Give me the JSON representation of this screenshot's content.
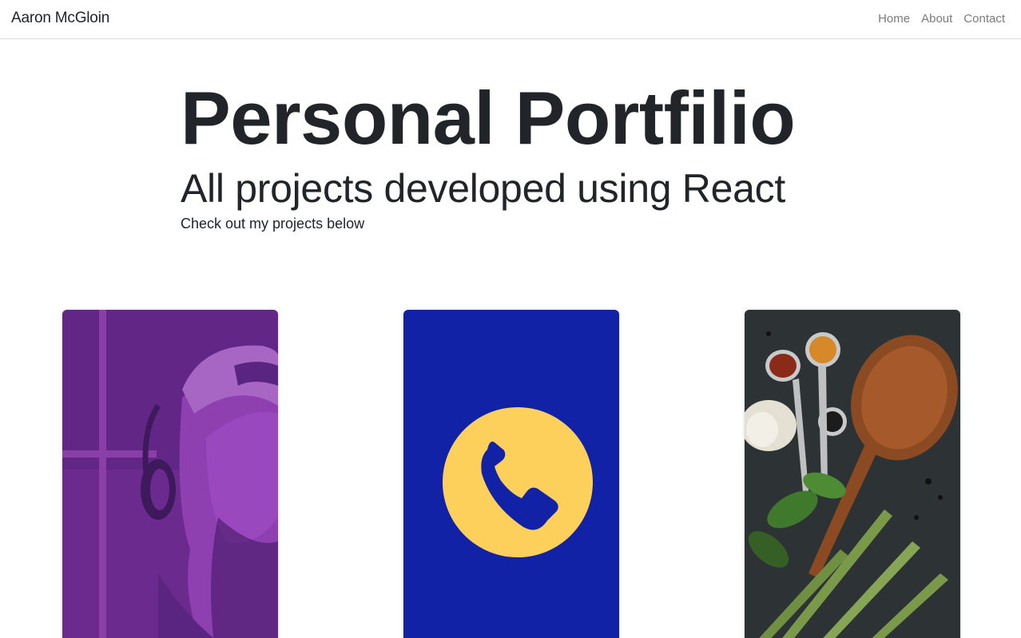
{
  "navbar": {
    "brand": "Aaron McGloin",
    "links": [
      "Home",
      "About",
      "Contact"
    ]
  },
  "hero": {
    "title": "Personal Portfilio",
    "subtitle": "All projects developed using React",
    "lead": "Check out my projects below"
  },
  "projects": [
    {
      "image": "duotone-portrait-headphones",
      "color": "#7a2d98"
    },
    {
      "image": "phone-icon",
      "background": "#1122a6",
      "accent": "#fdd05c"
    },
    {
      "image": "spices-wooden-spoon-asparagus",
      "color": "#3a3f44"
    }
  ]
}
